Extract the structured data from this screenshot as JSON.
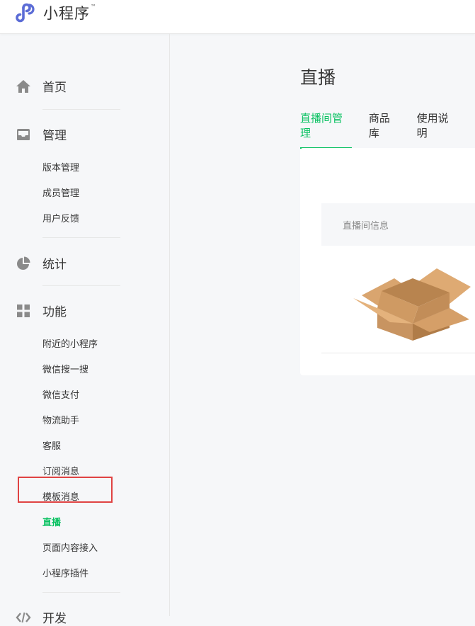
{
  "app": {
    "logo_text": "小程序",
    "logo_tm": "™",
    "brand_color": "#5b6cd6",
    "accent_color": "#07c160"
  },
  "sidebar": {
    "sections": [
      {
        "label": "首页",
        "icon": "home-icon"
      },
      {
        "label": "管理",
        "icon": "inbox-icon",
        "items": [
          "版本管理",
          "成员管理",
          "用户反馈"
        ]
      },
      {
        "label": "统计",
        "icon": "pie-chart-icon"
      },
      {
        "label": "功能",
        "icon": "grid-icon",
        "items": [
          "附近的小程序",
          "微信搜一搜",
          "微信支付",
          "物流助手",
          "客服",
          "订阅消息",
          "模板消息",
          "直播",
          "页面内容接入",
          "小程序插件"
        ]
      },
      {
        "label": "开发",
        "icon": "code-icon"
      }
    ],
    "active_item": "直播"
  },
  "main": {
    "title": "直播",
    "tabs": [
      {
        "label": "直播间管理",
        "active": true
      },
      {
        "label": "商品库",
        "active": false
      },
      {
        "label": "使用说明",
        "active": false
      }
    ],
    "card": {
      "info_label": "直播间信息",
      "empty_icon": "empty-box-icon"
    }
  }
}
